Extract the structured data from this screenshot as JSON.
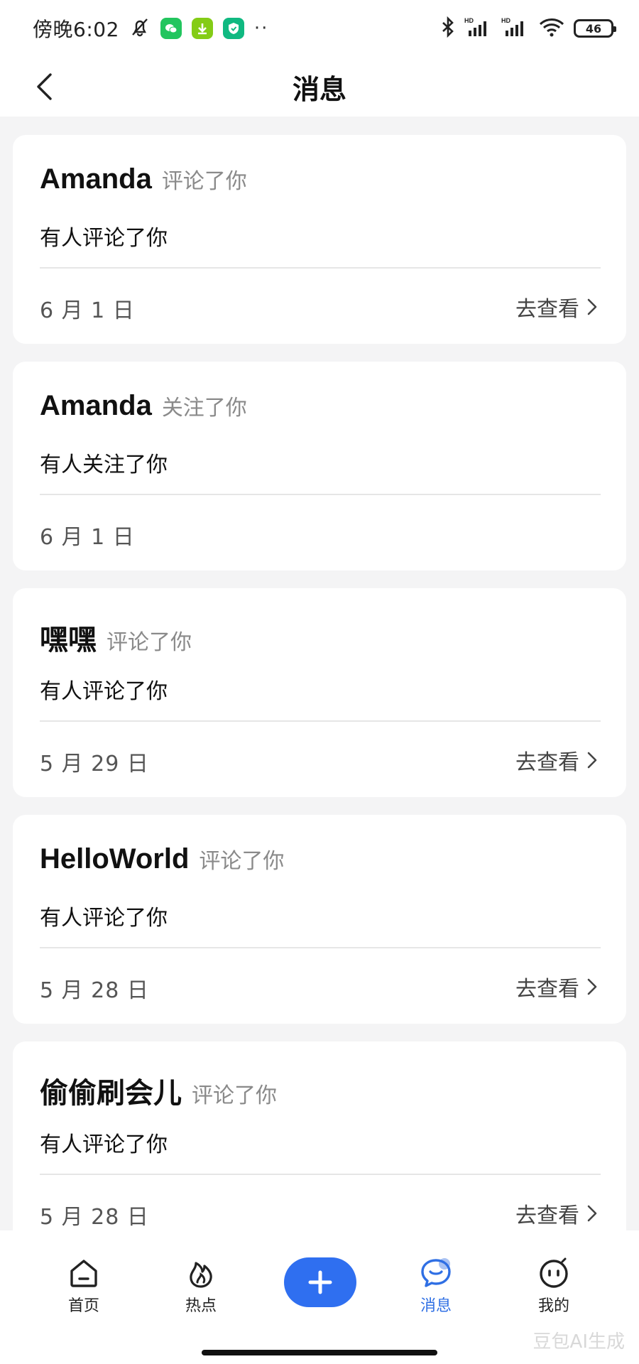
{
  "status_bar": {
    "time": "傍晚6:02",
    "more": "··",
    "battery": "46",
    "icons": [
      "bell-off-icon",
      "wechat-icon",
      "download-app-icon",
      "shield-app-icon",
      "bluetooth-icon",
      "signal-icon",
      "signal-icon",
      "wifi-icon",
      "battery-icon"
    ]
  },
  "header": {
    "title": "消息",
    "back_icon": "chevron-left-icon"
  },
  "messages": [
    {
      "name": "Amanda",
      "action": "评论了你",
      "body": "有人评论了你",
      "date": "6 月 1 日",
      "link": "去查看"
    },
    {
      "name": "Amanda",
      "action": "关注了你",
      "body": "有人关注了你",
      "date": "6 月 1 日",
      "link": ""
    },
    {
      "name": "嘿嘿",
      "action": "评论了你",
      "body": "有人评论了你",
      "date": "5 月 29 日",
      "link": "去查看"
    },
    {
      "name": "HelloWorld",
      "action": "评论了你",
      "body": "有人评论了你",
      "date": "5 月 28 日",
      "link": "去查看"
    },
    {
      "name": "偷偷刷会儿",
      "action": "评论了你",
      "body": "有人评论了你",
      "date": "5 月 28 日",
      "link": "去查看"
    }
  ],
  "nav": {
    "home": "首页",
    "hot": "热点",
    "messages": "消息",
    "mine": "我的",
    "active": "messages",
    "accent_color": "#2f6ff0"
  },
  "watermark": "豆包AI生成"
}
